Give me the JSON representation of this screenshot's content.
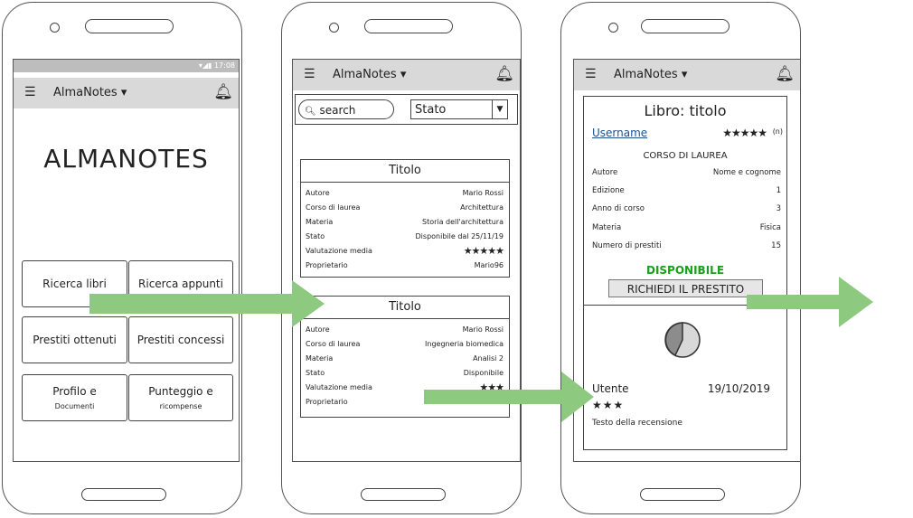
{
  "screen1": {
    "status": "17:08",
    "app_title": "AlmaNotes",
    "big_title": "ALMANOTES",
    "buttons": {
      "ricerca_libri": "Ricerca libri",
      "ricerca_appunti": "Ricerca appunti",
      "prestiti_ottenuti": "Prestiti ottenuti",
      "prestiti_concessi": "Prestiti concessi",
      "profilo": "Profilo e",
      "profilo_sub": "Documenti",
      "punteggio": "Punteggio e",
      "punteggio_sub": "ricompense"
    }
  },
  "screen2": {
    "app_title": "AlmaNotes",
    "search_placeholder": "search",
    "filter_value": "Stato",
    "cards": [
      {
        "title": "Titolo",
        "rows": [
          {
            "k": "Autore",
            "v": "Mario Rossi"
          },
          {
            "k": "Corso di laurea",
            "v": "Architettura"
          },
          {
            "k": "Materia",
            "v": "Storia dell'architettura"
          },
          {
            "k": "Stato",
            "v": "Disponibile dal 25/11/19"
          },
          {
            "k": "Valutazione media",
            "v": "★★★★★"
          },
          {
            "k": "Proprietario",
            "v": "Mario96"
          }
        ]
      },
      {
        "title": "Titolo",
        "rows": [
          {
            "k": "Autore",
            "v": "Mario Rossi"
          },
          {
            "k": "Corso di laurea",
            "v": "Ingegneria biomedica"
          },
          {
            "k": "Materia",
            "v": "Analisi 2"
          },
          {
            "k": "Stato",
            "v": "Disponibile"
          },
          {
            "k": "Valutazione media",
            "v": "★★★"
          },
          {
            "k": "Proprietario",
            "v": ""
          }
        ]
      }
    ]
  },
  "screen3": {
    "app_title": "AlmaNotes",
    "book_title": "Libro: titolo",
    "username": "Username",
    "user_rating": "★★★★★",
    "user_rating_count": "(n)",
    "corso": "CORSO DI LAUREA",
    "rows": [
      {
        "k": "Autore",
        "v": "Nome e cognome"
      },
      {
        "k": "Edizione",
        "v": "1"
      },
      {
        "k": "Anno di corso",
        "v": "3"
      },
      {
        "k": "Materia",
        "v": "Fisica"
      },
      {
        "k": "Numero di prestiti",
        "v": "15"
      }
    ],
    "availability": "DISPONIBILE",
    "request_button": "RICHIEDI IL PRESTITO",
    "review": {
      "user": "Utente",
      "date": "19/10/2019",
      "stars": "★★★",
      "text": "Testo della recensione"
    }
  },
  "colors": {
    "arrow": "#8dc97f",
    "available": "#18a018",
    "appbar": "#d9d9d9"
  }
}
